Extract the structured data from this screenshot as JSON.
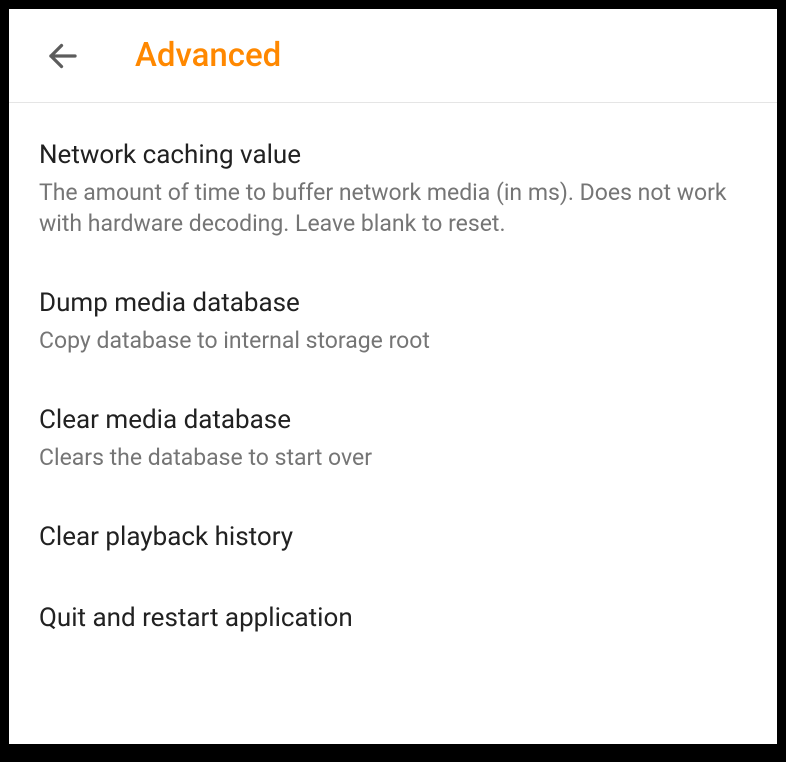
{
  "header": {
    "title": "Advanced"
  },
  "settings": [
    {
      "title": "Network caching value",
      "description": "The amount of time to buffer network media (in ms). Does not work with hardware decoding. Leave blank to reset."
    },
    {
      "title": "Dump media database",
      "description": "Copy database to internal storage root"
    },
    {
      "title": "Clear media database",
      "description": "Clears the database to start over"
    },
    {
      "title": "Clear playback history",
      "description": ""
    },
    {
      "title": "Quit and restart application",
      "description": ""
    }
  ]
}
